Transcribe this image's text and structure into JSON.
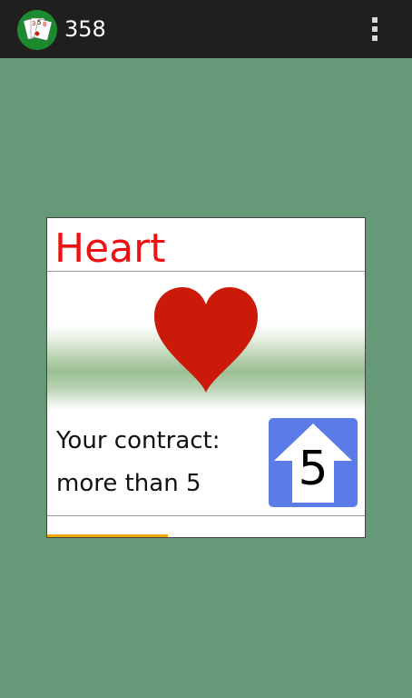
{
  "action_bar": {
    "title": "358",
    "app_icon": "playing-cards-icon",
    "menu_icon": "overflow-menu-icon"
  },
  "card": {
    "suit_name": "Heart",
    "suit_icon": "heart-suit-icon",
    "suit_color": "#ee1111",
    "heart_color": "#cc1a0a",
    "contract_line1": "Your contract:",
    "contract_line2": "more than 5",
    "contract_number": "5",
    "contract_badge_icon": "up-arrow-icon",
    "badge_color": "#5a7be8",
    "progress_fraction": 0.38,
    "progress_color": "#f0a800"
  },
  "colors": {
    "background": "#669977",
    "action_bar": "#1f1f1f"
  }
}
